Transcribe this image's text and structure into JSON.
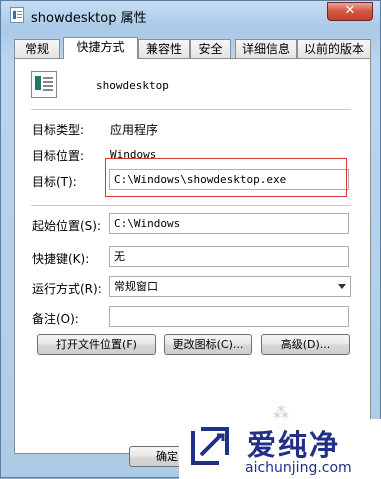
{
  "window": {
    "title": "showdesktop 属性",
    "close_glyph": "✕"
  },
  "tabs": [
    {
      "label": "常规"
    },
    {
      "label": "快捷方式"
    },
    {
      "label": "兼容性"
    },
    {
      "label": "安全"
    },
    {
      "label": "详细信息"
    },
    {
      "label": "以前的版本"
    }
  ],
  "shortcut": {
    "name": "showdesktop",
    "target_type_label": "目标类型:",
    "target_type_value": "应用程序",
    "target_location_label": "目标位置:",
    "target_location_value": "Windows",
    "target_label": "目标(T):",
    "target_value": "C:\\Windows\\showdesktop.exe",
    "start_in_label": "起始位置(S):",
    "start_in_value": "C:\\Windows",
    "hotkey_label": "快捷键(K):",
    "hotkey_value": "无",
    "run_label": "运行方式(R):",
    "run_value": "常规窗口",
    "comment_label": "备注(O):",
    "comment_value": ""
  },
  "buttons": {
    "open_location": "打开文件位置(F)",
    "change_icon": "更改图标(C)...",
    "advanced": "高级(D)...",
    "ok": "确定"
  },
  "watermark": {
    "brand_cn": "爱纯净",
    "url": "aichunjing.com"
  },
  "colors": {
    "highlight_box": "#d23a33",
    "watermark_text": "#1f2f8a"
  }
}
